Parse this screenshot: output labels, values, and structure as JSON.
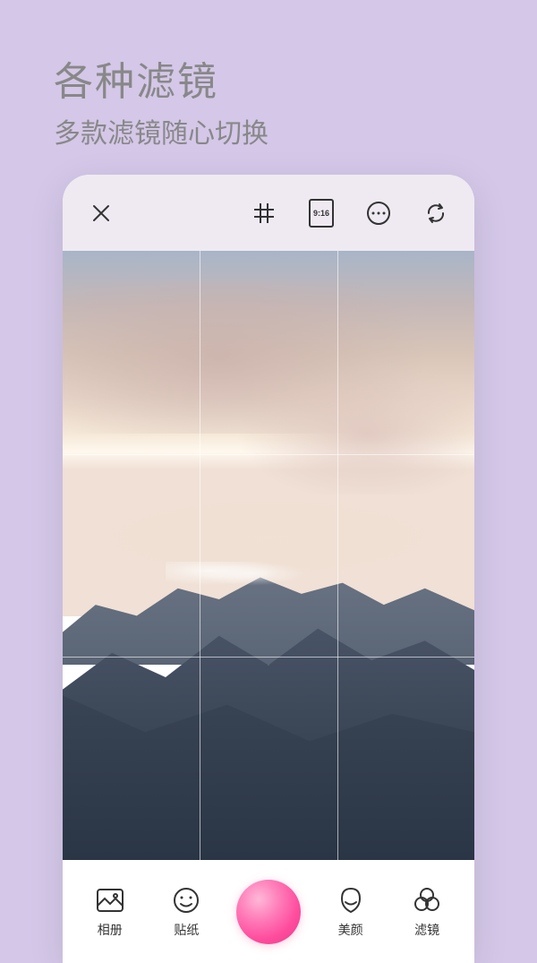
{
  "header": {
    "title": "各种滤镜",
    "subtitle": "多款滤镜随心切换"
  },
  "topBar": {
    "aspectRatio": "9:16"
  },
  "bottomBar": {
    "album": "相册",
    "sticker": "贴纸",
    "beauty": "美颜",
    "filter": "滤镜"
  }
}
